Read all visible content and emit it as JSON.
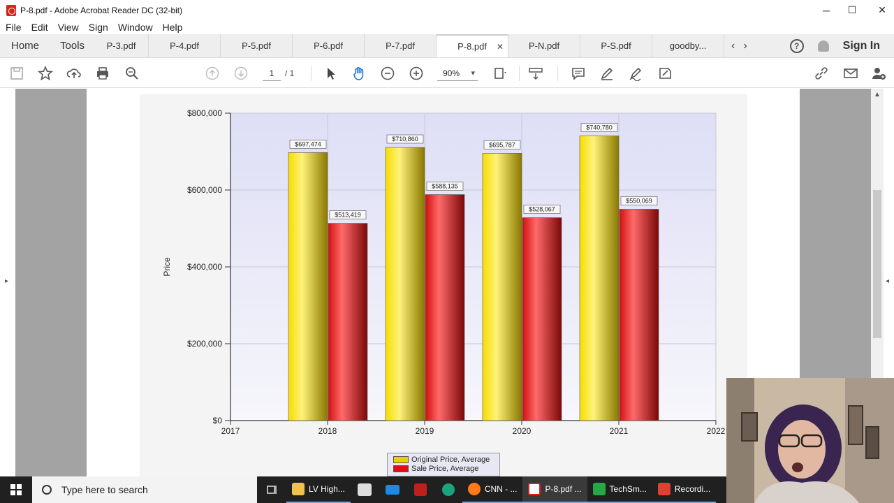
{
  "window": {
    "title": "P-8.pdf - Adobe Acrobat Reader DC (32-bit)"
  },
  "menu": [
    "File",
    "Edit",
    "View",
    "Sign",
    "Window",
    "Help"
  ],
  "tabs": {
    "home": "Home",
    "tools": "Tools",
    "docs": [
      "P-3.pdf",
      "P-4.pdf",
      "P-5.pdf",
      "P-6.pdf",
      "P-7.pdf",
      "P-8.pdf",
      "P-N.pdf",
      "P-S.pdf",
      "goodby..."
    ],
    "active_index": 5,
    "sign_in": "Sign In"
  },
  "toolbar": {
    "page_current": "1",
    "page_total": "/ 1",
    "zoom": "90%"
  },
  "chart_data": {
    "type": "bar",
    "title": "",
    "xlabel": "",
    "ylabel": "Price",
    "x_axis_ticks": [
      "2017",
      "2018",
      "2019",
      "2020",
      "2021",
      "2022"
    ],
    "y_axis_ticks": [
      "$0",
      "$200,000",
      "$400,000",
      "$600,000",
      "$800,000"
    ],
    "categories": [
      "2018",
      "2019",
      "2020",
      "2021"
    ],
    "ylim": [
      0,
      800000
    ],
    "series": [
      {
        "name": "Original Price, Average",
        "color": "#e8d000",
        "values": [
          697474,
          710860,
          695787,
          740780
        ],
        "labels": [
          "$697,474",
          "$710,860",
          "$695,787",
          "$740,780"
        ]
      },
      {
        "name": "Sale Price, Average",
        "color": "#e01010",
        "values": [
          513419,
          588135,
          528067,
          550069
        ],
        "labels": [
          "$513,419",
          "$588,135",
          "$528,067",
          "$550,069"
        ]
      }
    ],
    "legend_position": "bottom",
    "grid": true
  },
  "taskbar": {
    "search_placeholder": "Type here to search",
    "apps": [
      "LV High...",
      "CNN - ...",
      "P-8.pdf ...",
      "TechSm...",
      "Recordi..."
    ]
  }
}
